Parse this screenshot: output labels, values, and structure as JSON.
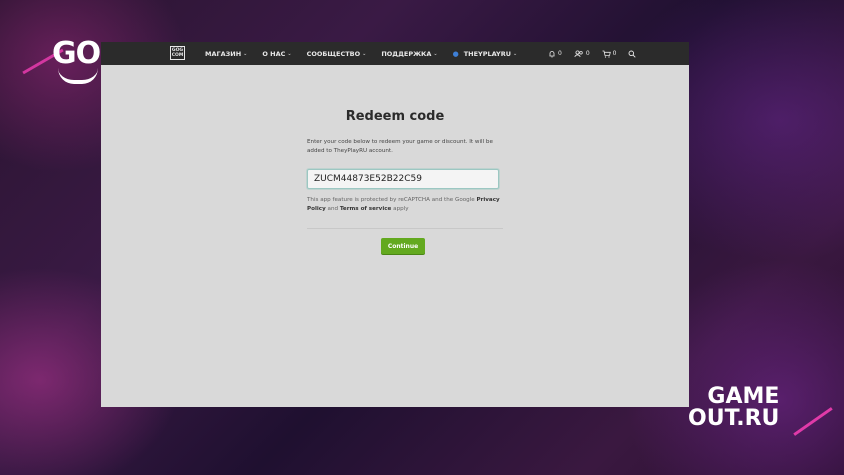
{
  "brand": {
    "corner_logo": "GO",
    "watermark_line1": "GAME",
    "watermark_line2": "OUT.RU",
    "accent_color": "#e03aa8"
  },
  "topbar": {
    "logo_text": "GOG COM",
    "nav": [
      {
        "label": "МАГАЗИН",
        "icon": "chevron-down-icon"
      },
      {
        "label": "О НАС",
        "icon": "chevron-down-icon"
      },
      {
        "label": "СООБЩЕСТВО",
        "icon": "chevron-down-icon"
      },
      {
        "label": "ПОДДЕРЖКА",
        "icon": "chevron-down-icon"
      },
      {
        "label": "THEYPLAYRU",
        "icon": "user-icon"
      }
    ],
    "notifications_count": "0",
    "friends_count": "0",
    "cart_count": "0"
  },
  "redeem": {
    "title": "Redeem code",
    "description": "Enter your code below to redeem your game or discount. It will be added to TheyPlayRU account.",
    "code_value": "ZUCM44873E52B22C59",
    "notice_prefix": "This app feature is protected by reCAPTCHA and the Google ",
    "privacy_link": "Privacy Policy",
    "notice_and": " and ",
    "terms_link": "Terms of service",
    "notice_suffix": " apply",
    "continue_label": "Continue",
    "button_color": "#63a91f"
  }
}
